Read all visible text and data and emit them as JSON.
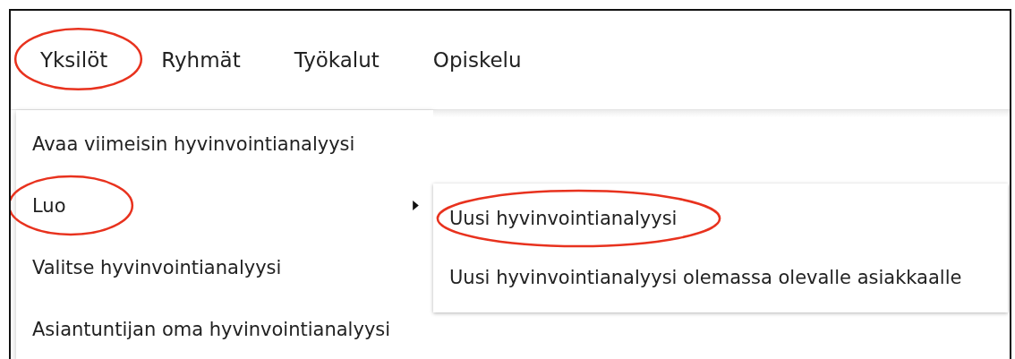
{
  "nav": [
    {
      "label": "Yksilöt",
      "highlighted": true
    },
    {
      "label": "Ryhmät",
      "highlighted": false
    },
    {
      "label": "Työkalut",
      "highlighted": false
    },
    {
      "label": "Opiskelu",
      "highlighted": false
    }
  ],
  "menu": [
    {
      "label": "Avaa viimeisin hyvinvointianalyysi",
      "kind": "action",
      "highlighted": false
    },
    {
      "label": "Luo",
      "kind": "submenu",
      "highlighted": true
    },
    {
      "label": "Valitse hyvinvointianalyysi",
      "kind": "action",
      "highlighted": false
    },
    {
      "label": "Asiantuntijan oma hyvinvointianalyysi",
      "kind": "action",
      "highlighted": false
    }
  ],
  "submenu": [
    {
      "label": "Uusi hyvinvointianalyysi",
      "highlighted": true
    },
    {
      "label": "Uusi hyvinvointianalyysi olemassa olevalle asiakkaalle",
      "highlighted": false
    }
  ]
}
